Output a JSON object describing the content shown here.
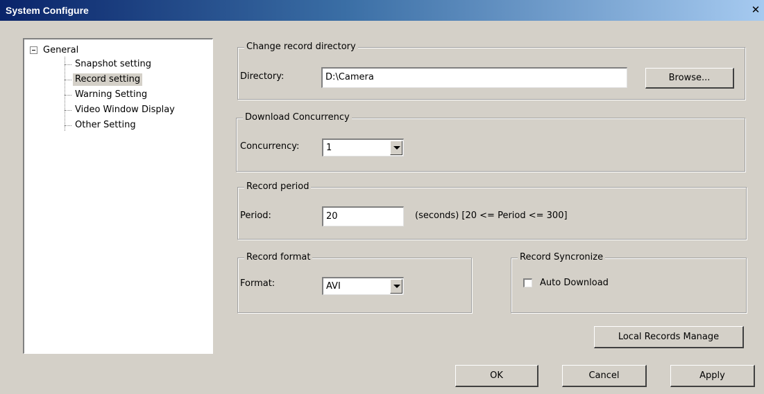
{
  "window": {
    "title": "System Configure",
    "close_label": "✕"
  },
  "tree": {
    "root_label": "General",
    "selected": "Record setting",
    "items": [
      {
        "label": "Snapshot setting"
      },
      {
        "label": "Record setting"
      },
      {
        "label": "Warning Setting"
      },
      {
        "label": "Video Window Display"
      },
      {
        "label": "Other Setting"
      }
    ]
  },
  "record_directory": {
    "legend": "Change record directory",
    "label": "Directory:",
    "value": "D:\\Camera",
    "browse_label": "Browse..."
  },
  "download_concurrency": {
    "legend": "Download Concurrency",
    "label": "Concurrency:",
    "value": "1"
  },
  "record_period": {
    "legend": "Record period",
    "label": "Period:",
    "value": "20",
    "hint": "(seconds)  [20 <= Period <= 300]"
  },
  "record_format": {
    "legend": "Record format",
    "label": "Format:",
    "value": "AVI"
  },
  "record_sync": {
    "legend": "Record Syncronize",
    "checkbox_label": "Auto Download",
    "checked": false
  },
  "buttons": {
    "local_records": "Local Records Manage",
    "ok": "OK",
    "cancel": "Cancel",
    "apply": "Apply"
  }
}
